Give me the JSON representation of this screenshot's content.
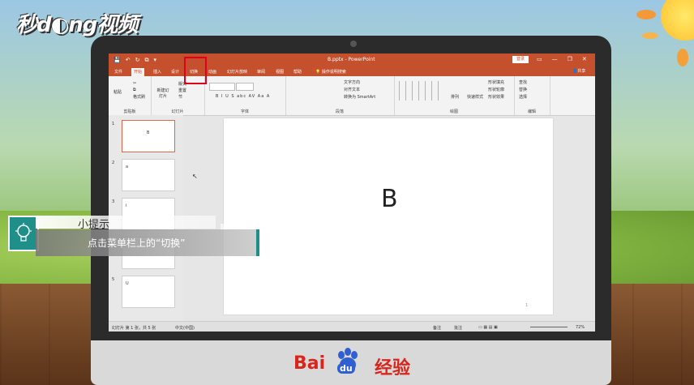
{
  "watermark": {
    "logo_text": "秒d◐ng视频"
  },
  "window": {
    "title": "B.pptx - PowerPoint",
    "login_label": "登录",
    "share_label": "共享",
    "quick_access": [
      "💾",
      "↶",
      "↻",
      "⧉",
      "▾"
    ],
    "controls": [
      "▭",
      "—",
      "❐",
      "✕"
    ]
  },
  "ribbon_tabs": [
    "文件",
    "开始",
    "插入",
    "设计",
    "切换",
    "动画",
    "幻灯片放映",
    "审阅",
    "视图",
    "帮助",
    "操作说明搜索"
  ],
  "active_tab_index": 1,
  "highlighted_tab_index": 4,
  "ribbon": {
    "clipboard": {
      "label": "剪贴板",
      "paste": "粘贴",
      "cut": "✂",
      "copy": "⧉",
      "format": "格式刷"
    },
    "slides": {
      "label": "幻灯片",
      "new": "新建幻灯片",
      "layout": "版式",
      "reset": "重置",
      "section": "节"
    },
    "font": {
      "label": "字体",
      "buttons": "B  I  U  S  abc  AV  Aa  A"
    },
    "paragraph": {
      "label": "段落",
      "text_direction": "文字方向",
      "align_text": "对齐文本",
      "smartart": "转换为 SmartArt"
    },
    "drawing": {
      "label": "绘图",
      "arrange": "排列",
      "quick_styles": "快速样式",
      "fill": "形状填充",
      "outline": "形状轮廓",
      "effects": "形状效果"
    },
    "editing": {
      "label": "编辑",
      "find": "查找",
      "replace": "替换",
      "select": "选择"
    }
  },
  "slides_panel": [
    {
      "number": "1",
      "text": "B"
    },
    {
      "number": "2",
      "text": "a"
    },
    {
      "number": "3",
      "text": "i"
    },
    {
      "number": "4",
      "text": ""
    },
    {
      "number": "5",
      "text": "U"
    }
  ],
  "selected_slide_index": 0,
  "slide": {
    "text": "B",
    "page_number": "1"
  },
  "status_bar": {
    "slide_info": "幻灯片 第 1 张，共 5 张",
    "language": "中文(中国)",
    "notes": "备注",
    "comments": "批注",
    "zoom": "72%"
  },
  "tip": {
    "title": "小提示",
    "text": "点击菜单栏上的“切换”"
  },
  "brand": {
    "bai": "Bai",
    "du": "du",
    "jingyan": "经验"
  },
  "colors": {
    "ribbon_accent": "#c4502e",
    "tip_teal": "#1f8f8a",
    "highlight": "#e0001a",
    "baidu_red": "#d9261c"
  }
}
